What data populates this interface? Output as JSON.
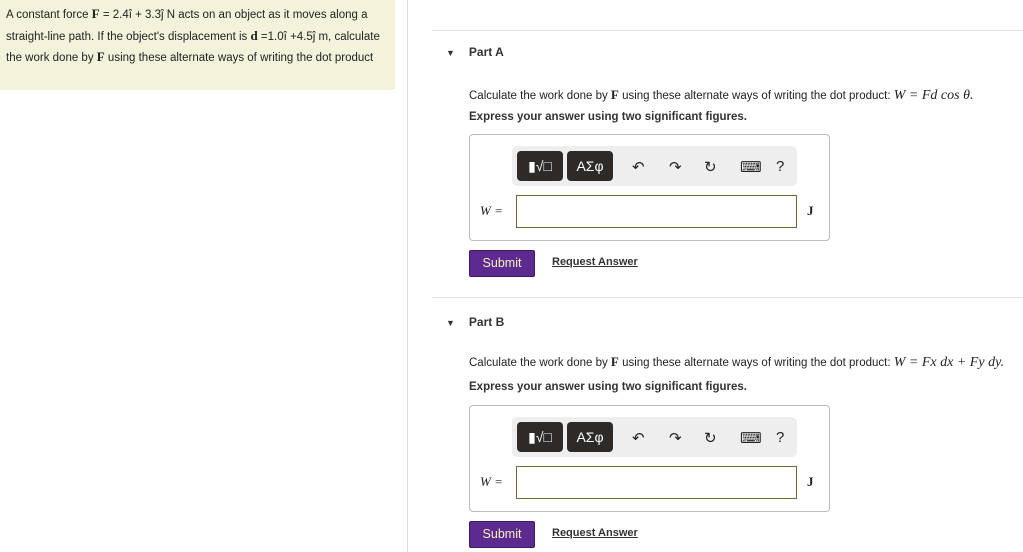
{
  "problem": {
    "p1": "A constant force ",
    "F": "F",
    "p2": " = 2.4",
    "i": "î",
    "p3": " + 3.3",
    "j": "ĵ",
    "p4": " N acts on an object as it moves along a straight-line path. If the object's displacement is ",
    "d": "d",
    "p5": " =1.0",
    "p6": " +4.5",
    "p7": " m, calculate the work done by ",
    "p8": " using these alternate ways of writing the dot product"
  },
  "parts": [
    {
      "title": "Part A",
      "question": "Calculate the work done by ",
      "F": "F",
      "question2": " using these alternate ways of writing the dot product: ",
      "formula": "W = Fd cos θ.",
      "express": "Express your answer using two significant figures.",
      "var": "W =",
      "unit": "J",
      "submit": "Submit",
      "request": "Request Answer"
    },
    {
      "title": "Part B",
      "question": "Calculate the work done by ",
      "F": "F",
      "question2": " using these alternate ways of writing the dot product: ",
      "formula": "W = Fx dx + Fy dy.",
      "express": "Express your answer using two significant figures.",
      "var": "W =",
      "unit": "J",
      "submit": "Submit",
      "request": "Request Answer"
    }
  ],
  "toolbar": {
    "templates": "▮√□",
    "symbols": "ΑΣφ",
    "undo": "↶",
    "redo": "↷",
    "reset": "↻",
    "keyboard": "⌨",
    "help": "?"
  }
}
